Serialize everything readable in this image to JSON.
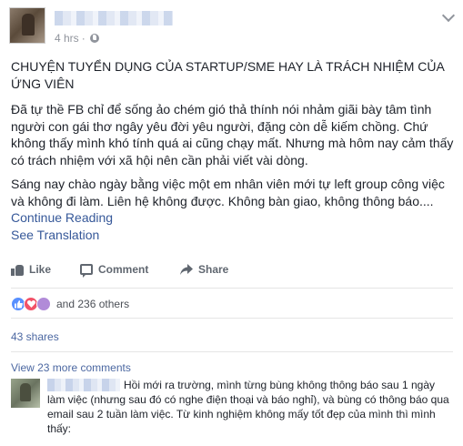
{
  "header": {
    "time": "4 hrs",
    "separator": "·",
    "privacy_icon": "globe-icon",
    "menu_icon": "chevron-down-icon"
  },
  "post": {
    "title": "CHUYỆN TUYỂN DỤNG CỦA STARTUP/SME HAY LÀ TRÁCH NHIỆM CỦA ỨNG VIÊN",
    "paragraph_1": "Đã tự thề FB chỉ để sống ảo chém gió thả thính nói nhảm giãi bày tâm tình người con gái thơ ngây yêu đời yêu người, đặng còn dễ kiếm chồng. Chứ không thấy mình khó tính quá ai cũng chạy mất. Nhưng mà hôm nay cảm thấy có trách nhiệm với xã hội nên cần phải viết vài dòng.",
    "paragraph_2": "Sáng nay chào ngày bằng việc một em nhân viên mới tự left group công việc và không đi làm. Liên hệ không được. Không bàn giao, không thông báo....",
    "continue_reading": "Continue Reading",
    "see_translation": "See Translation"
  },
  "actions": {
    "like": "Like",
    "comment": "Comment",
    "share": "Share"
  },
  "reactions": {
    "others": "and 236 others"
  },
  "shares": "43 shares",
  "comments": {
    "view_more": "View 23 more comments",
    "first_text": "Hồi mới ra trường, mình từng bùng không thông báo sau 1 ngày làm việc (nhưng sau đó có nghe điện thoại và báo nghỉ), và bùng có thông báo qua email sau 2 tuần làm việc. Từ kinh nghiệm không mấy tốt đẹp của mình thì mình thấy:"
  },
  "colors": {
    "link": "#365899",
    "meta": "#90949c",
    "like_reaction": "#5890ff",
    "love_reaction": "#f25268"
  }
}
